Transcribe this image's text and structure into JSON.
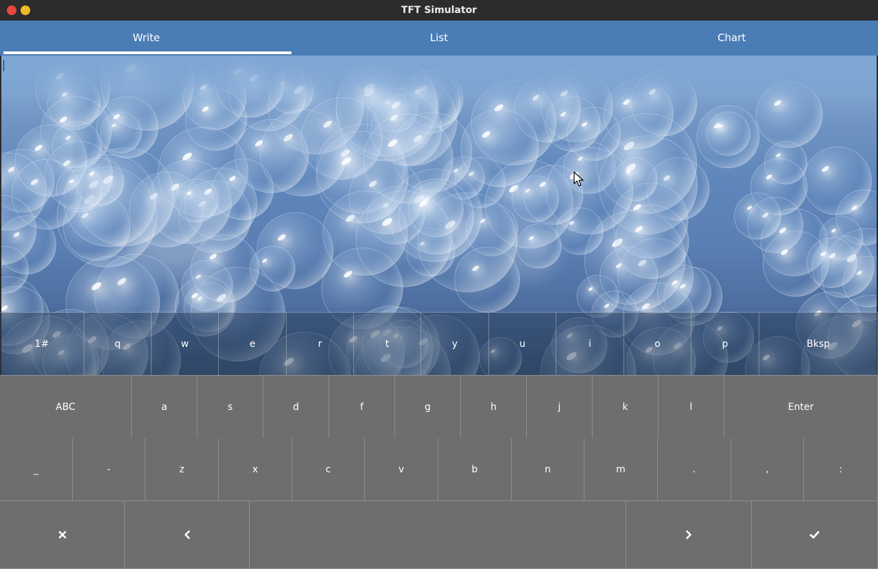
{
  "window": {
    "title": "TFT Simulator"
  },
  "tabs": [
    {
      "label": "Write",
      "active": true
    },
    {
      "label": "List",
      "active": false
    },
    {
      "label": "Chart",
      "active": false
    }
  ],
  "textarea": {
    "value": ""
  },
  "keyboard": {
    "row1": [
      "1#",
      "q",
      "w",
      "e",
      "r",
      "t",
      "y",
      "u",
      "i",
      "o",
      "p",
      "Bksp"
    ],
    "row2": [
      "ABC",
      "a",
      "s",
      "d",
      "f",
      "g",
      "h",
      "j",
      "k",
      "l",
      "Enter"
    ],
    "row3": [
      "_",
      "-",
      "z",
      "x",
      "c",
      "v",
      "b",
      "n",
      "m",
      ".",
      ",",
      ":"
    ],
    "row4_icons": [
      "close-icon",
      "chevron-left-icon",
      "space",
      "chevron-right-icon",
      "check-icon"
    ]
  },
  "colors": {
    "tabbar": "#4a7db6",
    "keys": "#6e6e6e",
    "titlebar": "#2c2c2c"
  }
}
